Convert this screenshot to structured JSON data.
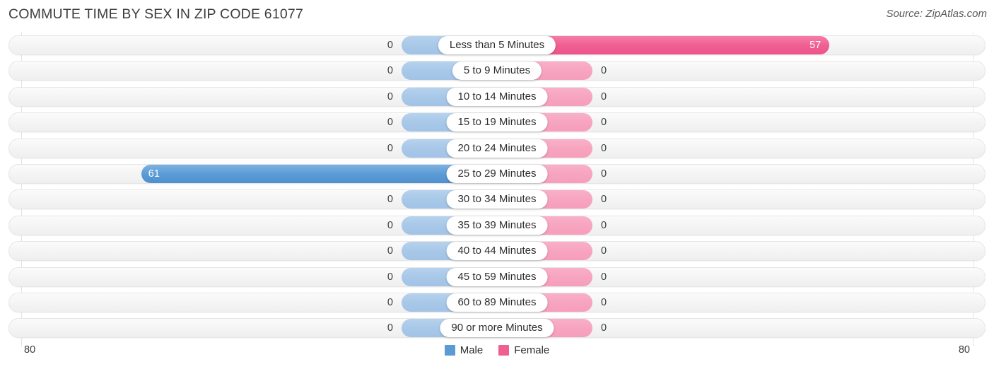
{
  "header": {
    "title": "COMMUTE TIME BY SEX IN ZIP CODE 61077",
    "source": "Source: ZipAtlas.com"
  },
  "legend": {
    "male_label": "Male",
    "female_label": "Female",
    "male_color": "#5b9bd5",
    "female_color": "#ef5f92"
  },
  "axis": {
    "left_max": "80",
    "right_max": "80"
  },
  "chart_data": {
    "type": "bar",
    "orientation": "horizontal-diverging",
    "title": "COMMUTE TIME BY SEX IN ZIP CODE 61077",
    "xlabel": "",
    "ylabel": "",
    "xlim": [
      80,
      80
    ],
    "grid": false,
    "legend_position": "bottom-center",
    "categories": [
      "Less than 5 Minutes",
      "5 to 9 Minutes",
      "10 to 14 Minutes",
      "15 to 19 Minutes",
      "20 to 24 Minutes",
      "25 to 29 Minutes",
      "30 to 34 Minutes",
      "35 to 39 Minutes",
      "40 to 44 Minutes",
      "45 to 59 Minutes",
      "60 to 89 Minutes",
      "90 or more Minutes"
    ],
    "series": [
      {
        "name": "Male",
        "values": [
          0,
          0,
          0,
          0,
          0,
          61,
          0,
          0,
          0,
          0,
          0,
          0
        ]
      },
      {
        "name": "Female",
        "values": [
          57,
          0,
          0,
          0,
          0,
          0,
          0,
          0,
          0,
          0,
          0,
          0
        ]
      }
    ]
  },
  "rows": [
    {
      "label": "Less than 5 Minutes",
      "male": "0",
      "female": "57"
    },
    {
      "label": "5 to 9 Minutes",
      "male": "0",
      "female": "0"
    },
    {
      "label": "10 to 14 Minutes",
      "male": "0",
      "female": "0"
    },
    {
      "label": "15 to 19 Minutes",
      "male": "0",
      "female": "0"
    },
    {
      "label": "20 to 24 Minutes",
      "male": "0",
      "female": "0"
    },
    {
      "label": "25 to 29 Minutes",
      "male": "61",
      "female": "0"
    },
    {
      "label": "30 to 34 Minutes",
      "male": "0",
      "female": "0"
    },
    {
      "label": "35 to 39 Minutes",
      "male": "0",
      "female": "0"
    },
    {
      "label": "40 to 44 Minutes",
      "male": "0",
      "female": "0"
    },
    {
      "label": "45 to 59 Minutes",
      "male": "0",
      "female": "0"
    },
    {
      "label": "60 to 89 Minutes",
      "male": "0",
      "female": "0"
    },
    {
      "label": "90 or more Minutes",
      "male": "0",
      "female": "0"
    }
  ]
}
